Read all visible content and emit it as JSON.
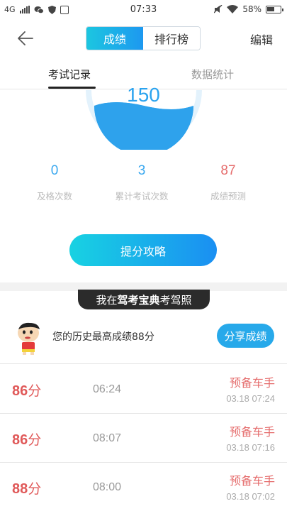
{
  "status_bar": {
    "network": "4G",
    "time": "07:33",
    "battery": "58%",
    "battery_level": 0.58
  },
  "header": {
    "segments": [
      "成绩",
      "排行榜"
    ],
    "active_segment": 0,
    "edit_label": "编辑"
  },
  "tabs": [
    "考试记录",
    "数据统计"
  ],
  "score": {
    "value": "150"
  },
  "stats": [
    {
      "value": "0",
      "label": "及格次数"
    },
    {
      "value": "3",
      "label": "累计考试次数"
    },
    {
      "value": "87",
      "label": "成绩预测"
    }
  ],
  "strategy_button": "提分攻略",
  "banner": {
    "prefix": "我在",
    "brand": "驾考宝典",
    "suffix": "考驾照"
  },
  "best": {
    "text": "您的历史最高成绩88分",
    "share_label": "分享成绩"
  },
  "records": [
    {
      "score": "86",
      "unit": "分",
      "duration": "06:24",
      "title": "预备车手",
      "time": "03.18  07:24"
    },
    {
      "score": "86",
      "unit": "分",
      "duration": "08:07",
      "title": "预备车手",
      "time": "03.18  07:16"
    },
    {
      "score": "88",
      "unit": "分",
      "duration": "08:00",
      "title": "预备车手",
      "time": "03.18  07:02"
    }
  ],
  "colors": {
    "accent_start": "#18d2e2",
    "accent_end": "#1a8ff2",
    "score_red": "#e05a5a",
    "stat_blue": "#3aa8ef"
  }
}
